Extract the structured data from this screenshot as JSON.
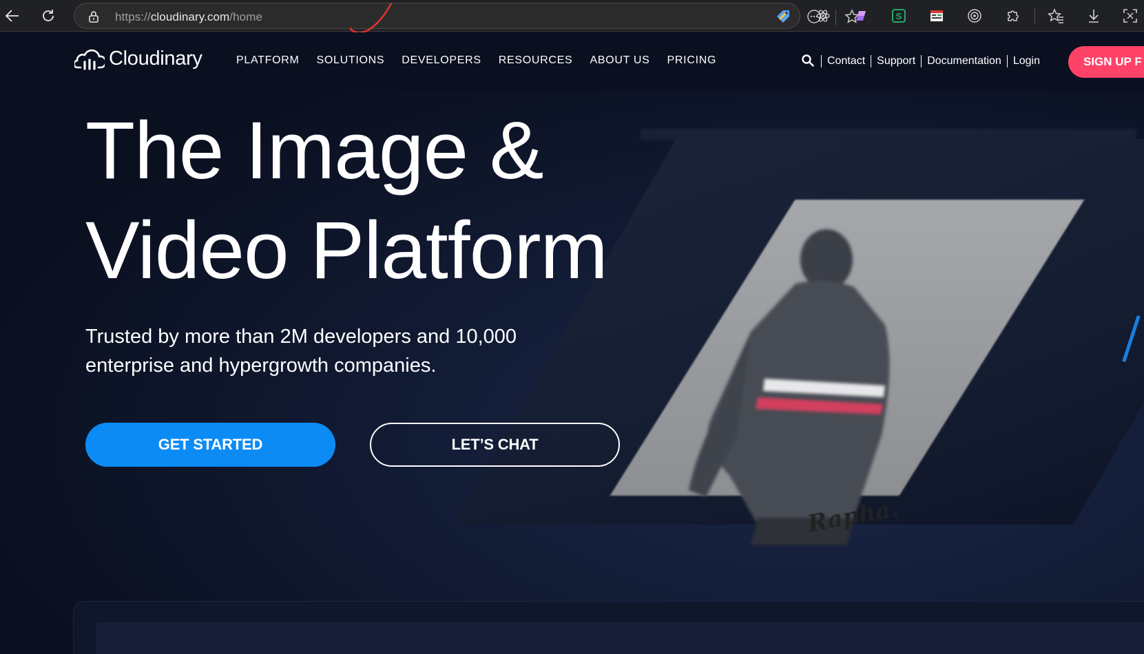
{
  "browser": {
    "url_prefix": "https://",
    "url_host": "cloudinary.com",
    "url_path": "/home",
    "toolbar_icons": [
      "back-icon",
      "reload-icon",
      "lock-icon",
      "tag-icon",
      "reader-icon",
      "favorite-star-icon",
      "react-devtools-icon",
      "extension-purple-icon",
      "extension-s-icon",
      "extension-page-icon",
      "target-icon",
      "extensions-puzzle-icon",
      "favorites-icon",
      "download-icon",
      "screenshot-icon"
    ]
  },
  "header": {
    "logo_text": "Cloudinary",
    "nav": [
      "PLATFORM",
      "SOLUTIONS",
      "DEVELOPERS",
      "RESOURCES",
      "ABOUT US",
      "PRICING"
    ],
    "utility": [
      "Contact",
      "Support",
      "Documentation",
      "Login"
    ],
    "signup_label": "SIGN UP F"
  },
  "hero": {
    "title_line1": "The Image &",
    "title_line2": "Video Platform",
    "subtitle_line1": "Trusted by more than 2M developers and 10,000",
    "subtitle_line2": "enterprise and hypergrowth companies.",
    "primary_cta": "GET STARTED",
    "secondary_cta": "LET’S CHAT",
    "image_brand": "Rapha."
  },
  "colors": {
    "background": "#0c1221",
    "primary_blue": "#0c8bf5",
    "signup_pink": "#ff4268",
    "text": "#ffffff"
  }
}
